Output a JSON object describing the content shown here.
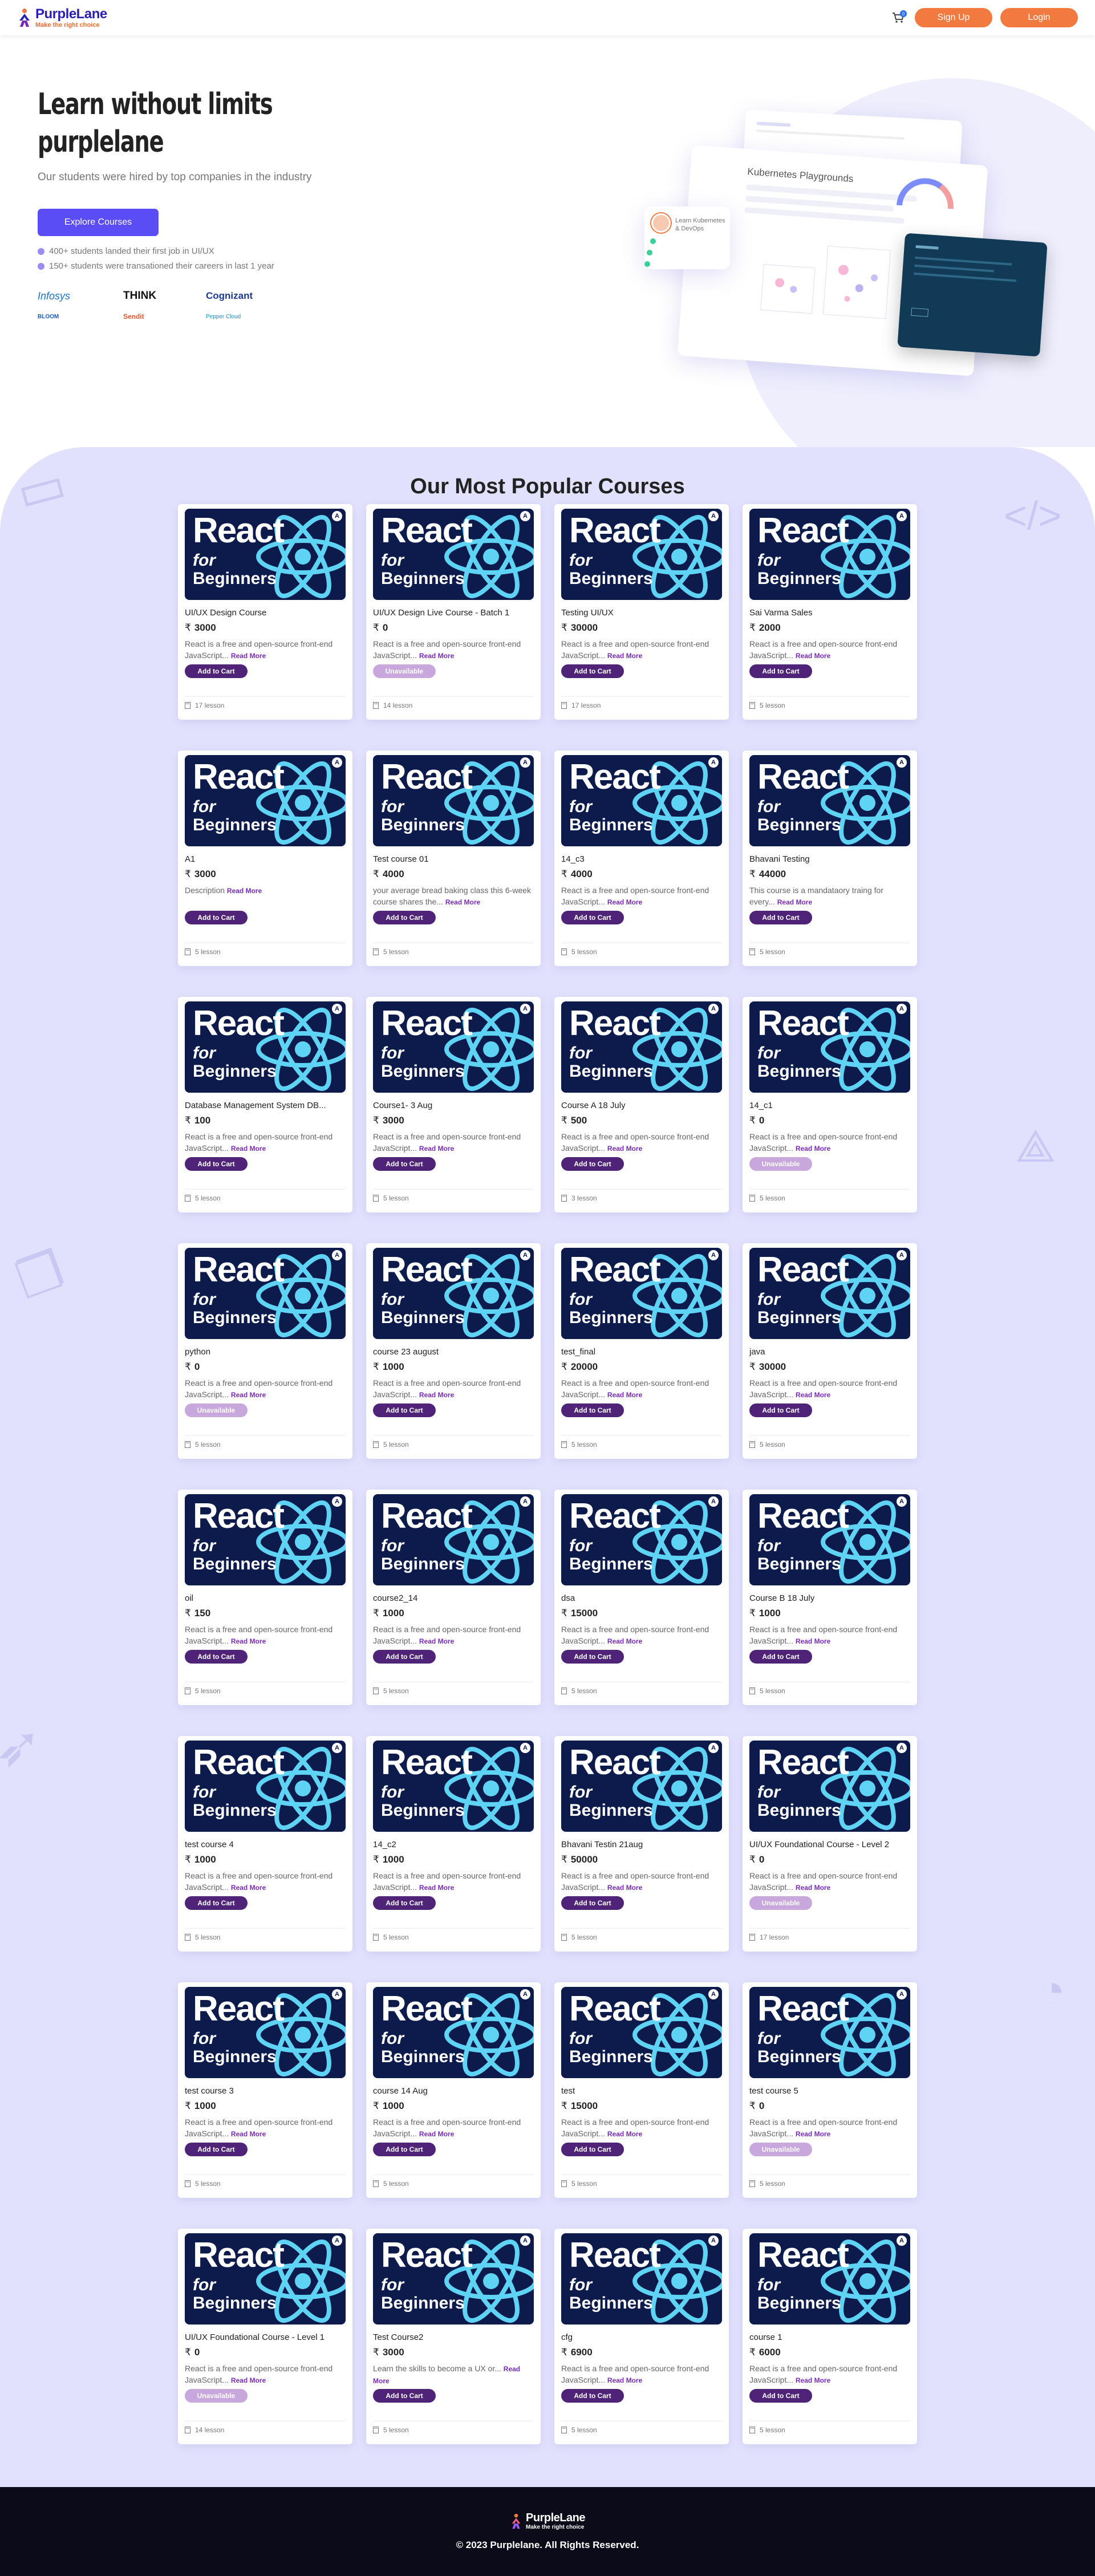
{
  "header": {
    "logo_name": "PurpleLane",
    "logo_tagline": "Make the right choice",
    "cart_count": "0",
    "signup_label": "Sign Up",
    "login_label": "Login"
  },
  "hero": {
    "title_line1": "Learn without limits",
    "title_line2": "purplelane",
    "subtitle": "Our students were hired by top companies in the industry",
    "cta_label": "Explore Courses",
    "bullets": [
      "400+ students landed their first job in UI/UX",
      "150+ students were transationed their careers in last 1 year"
    ],
    "companies": [
      "Infosys",
      "THINK",
      "Cognizant",
      "BLOOM",
      "Sendit",
      "Pepper Cloud"
    ],
    "mock": {
      "playground_title": "Kubernetes Playgrounds",
      "learn_text": "Learn Kubernetes & DevOps"
    }
  },
  "courses_section": {
    "title": "Our Most Popular Courses",
    "thumb_line1": "React",
    "thumb_line2": "for",
    "thumb_line3": "Beginners",
    "read_more": "Read More",
    "currency": "₹",
    "courses": [
      {
        "title": "UI/UX Design Course",
        "price": "3000",
        "desc": "React is a free and open-source front-end JavaScript...",
        "button": "Add to Cart",
        "lessons": "17 lesson"
      },
      {
        "title": "UI/UX Design Live Course - Batch 1",
        "price": "0",
        "desc": "React is a free and open-source front-end JavaScript...",
        "button": "Unavailable",
        "lessons": "14 lesson"
      },
      {
        "title": "Testing UI/UX",
        "price": "30000",
        "desc": "React is a free and open-source front-end JavaScript...",
        "button": "Add to Cart",
        "lessons": "17 lesson"
      },
      {
        "title": "Sai Varma Sales",
        "price": "2000",
        "desc": "React is a free and open-source front-end JavaScript...",
        "button": "Add to Cart",
        "lessons": "5 lesson"
      },
      {
        "title": "A1",
        "price": "3000",
        "desc": "Description",
        "button": "Add to Cart",
        "lessons": "5 lesson"
      },
      {
        "title": "Test course 01",
        "price": "4000",
        "desc": "your average bread baking class this 6-week course shares the...",
        "button": "Add to Cart",
        "lessons": "5 lesson"
      },
      {
        "title": "14_c3",
        "price": "4000",
        "desc": "React is a free and open-source front-end JavaScript...",
        "button": "Add to Cart",
        "lessons": "5 lesson"
      },
      {
        "title": "Bhavani Testing",
        "price": "44000",
        "desc": "This course is a mandataory traing for every...",
        "button": "Add to Cart",
        "lessons": "5 lesson"
      },
      {
        "title": "Database Management System DB...",
        "price": "100",
        "desc": "React is a free and open-source front-end JavaScript...",
        "button": "Add to Cart",
        "lessons": "5 lesson"
      },
      {
        "title": "Course1- 3 Aug",
        "price": "3000",
        "desc": "React is a free and open-source front-end JavaScript...",
        "button": "Add to Cart",
        "lessons": "5 lesson"
      },
      {
        "title": "Course A 18 July",
        "price": "500",
        "desc": "React is a free and open-source front-end JavaScript...",
        "button": "Add to Cart",
        "lessons": "3 lesson"
      },
      {
        "title": "14_c1",
        "price": "0",
        "desc": "React is a free and open-source front-end JavaScript...",
        "button": "Unavailable",
        "lessons": "5 lesson"
      },
      {
        "title": "python",
        "price": "0",
        "desc": "React is a free and open-source front-end JavaScript...",
        "button": "Unavailable",
        "lessons": "5 lesson"
      },
      {
        "title": "course 23 august",
        "price": "1000",
        "desc": "React is a free and open-source front-end JavaScript...",
        "button": "Add to Cart",
        "lessons": "5 lesson"
      },
      {
        "title": "test_final",
        "price": "20000",
        "desc": "React is a free and open-source front-end JavaScript...",
        "button": "Add to Cart",
        "lessons": "5 lesson"
      },
      {
        "title": "java",
        "price": "30000",
        "desc": "React is a free and open-source front-end JavaScript...",
        "button": "Add to Cart",
        "lessons": "5 lesson"
      },
      {
        "title": "oil",
        "price": "150",
        "desc": "React is a free and open-source front-end JavaScript...",
        "button": "Add to Cart",
        "lessons": "5 lesson"
      },
      {
        "title": "course2_14",
        "price": "1000",
        "desc": "React is a free and open-source front-end JavaScript...",
        "button": "Add to Cart",
        "lessons": "5 lesson"
      },
      {
        "title": "dsa",
        "price": "15000",
        "desc": "React is a free and open-source front-end JavaScript...",
        "button": "Add to Cart",
        "lessons": "5 lesson"
      },
      {
        "title": "Course B 18 July",
        "price": "1000",
        "desc": "React is a free and open-source front-end JavaScript...",
        "button": "Add to Cart",
        "lessons": "5 lesson"
      },
      {
        "title": "test course 4",
        "price": "1000",
        "desc": "React is a free and open-source front-end JavaScript...",
        "button": "Add to Cart",
        "lessons": "5 lesson"
      },
      {
        "title": "14_c2",
        "price": "1000",
        "desc": "React is a free and open-source front-end JavaScript...",
        "button": "Add to Cart",
        "lessons": "5 lesson"
      },
      {
        "title": "Bhavani Testin 21aug",
        "price": "50000",
        "desc": "React is a free and open-source front-end JavaScript...",
        "button": "Add to Cart",
        "lessons": "5 lesson"
      },
      {
        "title": "UI/UX Foundational Course - Level 2",
        "price": "0",
        "desc": "React is a free and open-source front-end JavaScript...",
        "button": "Unavailable",
        "lessons": "17 lesson"
      },
      {
        "title": "test course 3",
        "price": "1000",
        "desc": "React is a free and open-source front-end JavaScript...",
        "button": "Add to Cart",
        "lessons": "5 lesson"
      },
      {
        "title": "course 14 Aug",
        "price": "1000",
        "desc": "React is a free and open-source front-end JavaScript...",
        "button": "Add to Cart",
        "lessons": "5 lesson"
      },
      {
        "title": "test",
        "price": "15000",
        "desc": "React is a free and open-source front-end JavaScript...",
        "button": "Add to Cart",
        "lessons": "5 lesson"
      },
      {
        "title": "test course 5",
        "price": "0",
        "desc": "React is a free and open-source front-end JavaScript...",
        "button": "Unavailable",
        "lessons": "5 lesson"
      },
      {
        "title": "UI/UX Foundational Course - Level 1",
        "price": "0",
        "desc": "React is a free and open-source front-end JavaScript...",
        "button": "Unavailable",
        "lessons": "14 lesson"
      },
      {
        "title": "Test Course2",
        "price": "3000",
        "desc": "Learn the skills to become a UX or...",
        "button": "Add to Cart",
        "lessons": "5 lesson"
      },
      {
        "title": "cfg",
        "price": "6900",
        "desc": "React is a free and open-source front-end JavaScript...",
        "button": "Add to Cart",
        "lessons": "5 lesson"
      },
      {
        "title": "course 1",
        "price": "6000",
        "desc": "React is a free and open-source front-end JavaScript...",
        "button": "Add to Cart",
        "lessons": "5 lesson"
      }
    ]
  },
  "footer": {
    "logo_name": "PurpleLane",
    "logo_tagline": "Make the right choice",
    "copyright": "© 2023 Purplelane. All Rights Reserved."
  },
  "colors": {
    "brand_orange": "#f37a3f",
    "brand_indigo": "#2a1fb0",
    "cta_purple": "#5b4df6",
    "card_button": "#4f2378",
    "unavailable_button": "#c8a7dd",
    "section_bg": "#e2e1fd"
  },
  "icons": [
    "cart-icon",
    "book-icon",
    "react-atom-icon",
    "bullet-dot-icon"
  ]
}
